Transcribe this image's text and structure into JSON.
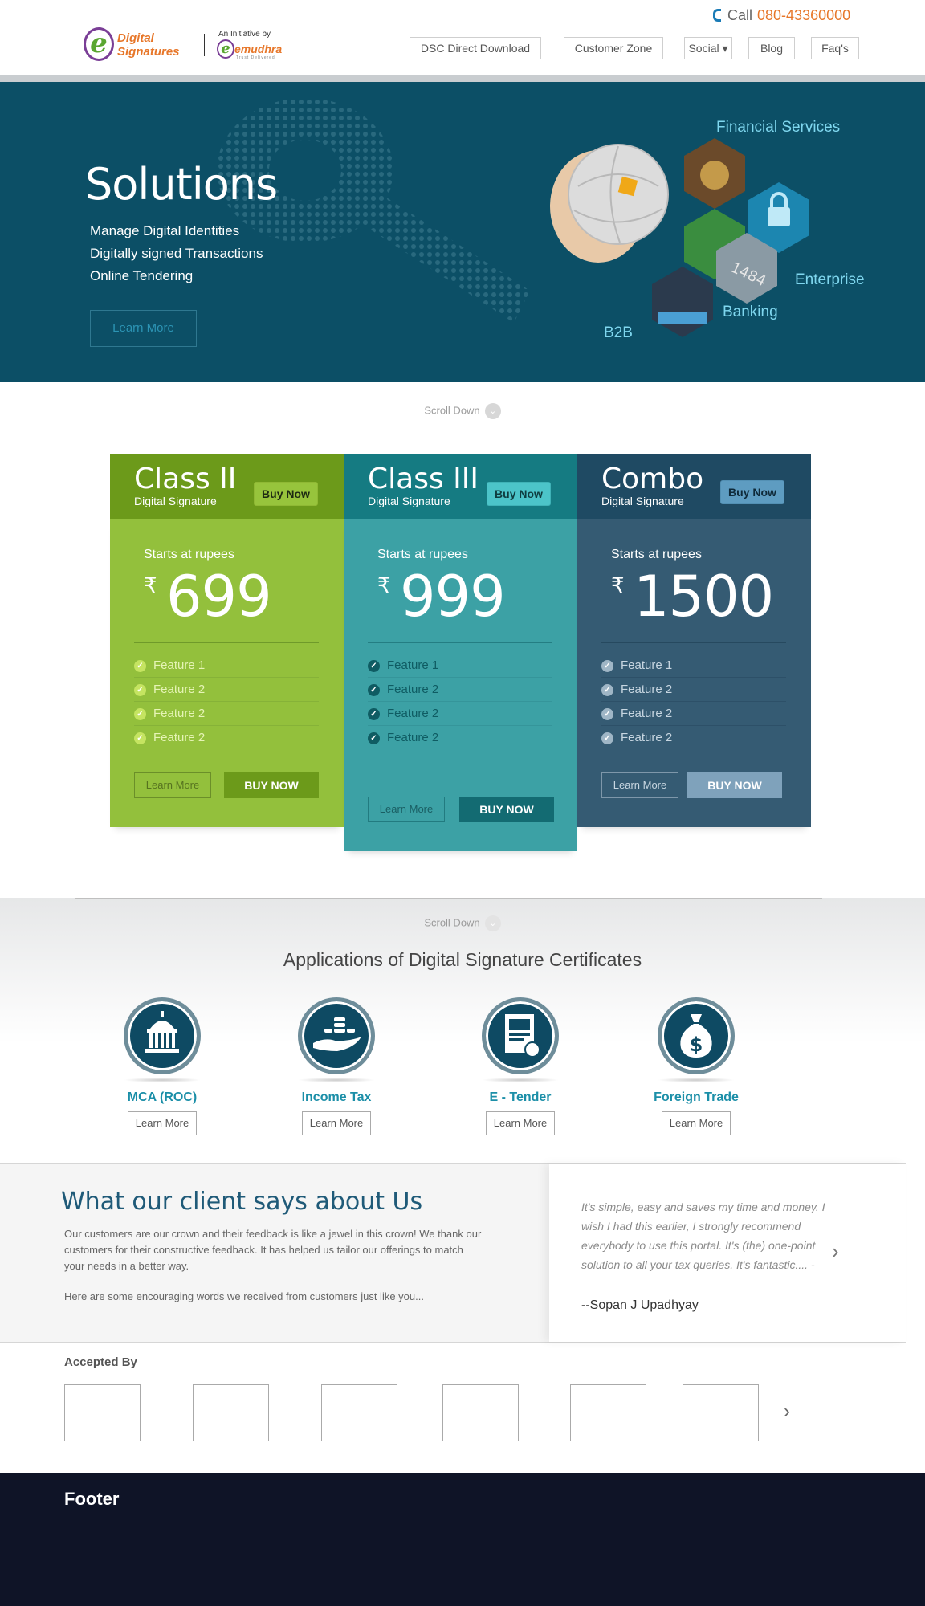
{
  "header": {
    "logo": {
      "line1": "Digital",
      "line2": "Signatures",
      "initiative": "An Initiative by",
      "partner": "emudhra",
      "partner_tag": "Trust Delivered"
    },
    "call_label": "Call",
    "phone": "080-43360000",
    "nav": [
      "DSC Direct Download",
      "Customer Zone",
      "Social ▾",
      "Blog",
      "Faq's"
    ]
  },
  "hero": {
    "title": "Solutions",
    "items": [
      "Manage Digital Identities",
      "Digitally signed Transactions",
      "Online Tendering"
    ],
    "learn_more": "Learn More",
    "labels": {
      "financial": "Financial Services",
      "enterprise": "Enterprise",
      "banking": "Banking",
      "b2b": "B2B"
    }
  },
  "scroll_down": "Scroll Down",
  "plans": [
    {
      "name": "Class II",
      "sub": "Digital Signature",
      "buy_top": "Buy Now",
      "starts": "Starts at rupees",
      "rupee": "₹",
      "price": "699",
      "features": [
        "Feature 1",
        "Feature 2",
        "Feature 2",
        "Feature 2"
      ],
      "learn": "Learn More",
      "buy": "BUY NOW",
      "colors": {
        "head": "#6c9a1a",
        "body": "#93c03c",
        "btn_top": "#97c43c",
        "feat": "#e6f4b6",
        "check": "#c5e461",
        "buy": "#6c9a1a",
        "learn_border": "#6b8f29",
        "learn_text": "#56731f",
        "divider": "#6f9a2a"
      }
    },
    {
      "name": "Class III",
      "sub": "Digital Signature",
      "buy_top": "Buy Now",
      "starts": "Starts at rupees",
      "rupee": "₹",
      "price": "999",
      "features": [
        "Feature 1",
        "Feature 2",
        "Feature 2",
        "Feature 2"
      ],
      "learn": "Learn More",
      "buy": "BUY NOW",
      "colors": {
        "head": "#157b82",
        "body": "#3ca1a5",
        "btn_top": "#4cc4c9",
        "feat": "#0f5c63",
        "check": "#0f5c63",
        "buy": "#136b72",
        "learn_border": "#227b80",
        "learn_text": "#1a5e63",
        "divider": "#247e83"
      }
    },
    {
      "name": "Combo",
      "sub": "Digital Signature",
      "buy_top": "Buy Now",
      "starts": "Starts at rupees",
      "rupee": "₹",
      "price": "1500",
      "features": [
        "Feature 1",
        "Feature 2",
        "Feature 2",
        "Feature 2"
      ],
      "learn": "Learn More",
      "buy": "BUY NOW",
      "colors": {
        "head": "#1f4a63",
        "body": "#355b73",
        "btn_top": "#5e9cc1",
        "feat": "#c7d6e1",
        "check": "#9fb6c6",
        "buy": "#7fa2bb",
        "learn_border": "#7e97aa",
        "learn_text": "#c7d6e1",
        "divider": "#26495f"
      }
    }
  ],
  "applications": {
    "title": "Applications of Digital Signature Certificates",
    "items": [
      {
        "label": "MCA (ROC)",
        "icon": "government-building-icon",
        "learn": "Learn More"
      },
      {
        "label": "Income Tax",
        "icon": "hand-coins-icon",
        "learn": "Learn More"
      },
      {
        "label": "E - Tender",
        "icon": "certificate-document-icon",
        "learn": "Learn More"
      },
      {
        "label": "Foreign Trade",
        "icon": "money-bag-icon",
        "learn": "Learn More"
      }
    ]
  },
  "testimonial": {
    "title": "What our client says about Us",
    "p1": "Our customers are our crown and their feedback is like a jewel in this crown! We thank our customers for their constructive feedback. It has helped us tailor our offerings to match your needs in a better way.",
    "p2": "Here are some encouraging words we received from customers just like you...",
    "quote": "It's simple, easy and saves my time and money. I wish I had this earlier, I strongly recommend everybody to use this portal. It's (the) one-point solution     to all your tax queries. It's fantastic.... -",
    "author": "--Sopan J Upadhyay",
    "next": "›"
  },
  "accepted": {
    "title": "Accepted By",
    "next": "›"
  },
  "footer": {
    "title": "Footer"
  }
}
